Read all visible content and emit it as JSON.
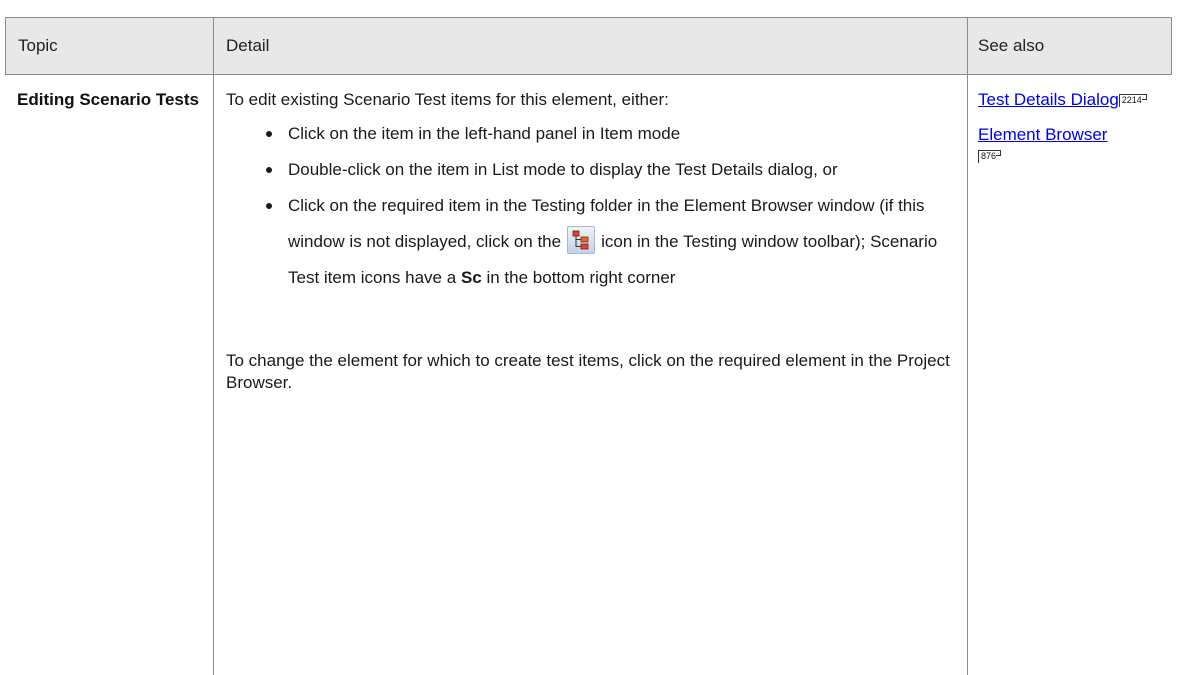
{
  "header": {
    "topic": "Topic",
    "detail": "Detail",
    "see_also": "See also"
  },
  "row": {
    "topic": "Editing Scenario Tests",
    "intro": "To edit existing Scenario Test items for this element, either:",
    "bullets": [
      "Click on the item in the left-hand panel in Item mode",
      "Double-click on the item in List mode to display the Test Details dialog, or"
    ],
    "bullet3_before": "Click on the required item in the Testing folder in the Element Browser window (if this window is not displayed, click on the",
    "bullet3_after": "icon in the Testing window toolbar); Scenario Test item icons have a",
    "bullet3_bold": "Sc",
    "bullet3_end": "in the bottom right corner",
    "toolbar_icon": "element-browser-icon",
    "para2": "To change the element for which to create test items, click on the required element in the Project Browser.",
    "see_also": [
      {
        "label": "Test Details Dialog",
        "page": "2214"
      },
      {
        "label": "Element Browser",
        "page": "876"
      }
    ]
  }
}
